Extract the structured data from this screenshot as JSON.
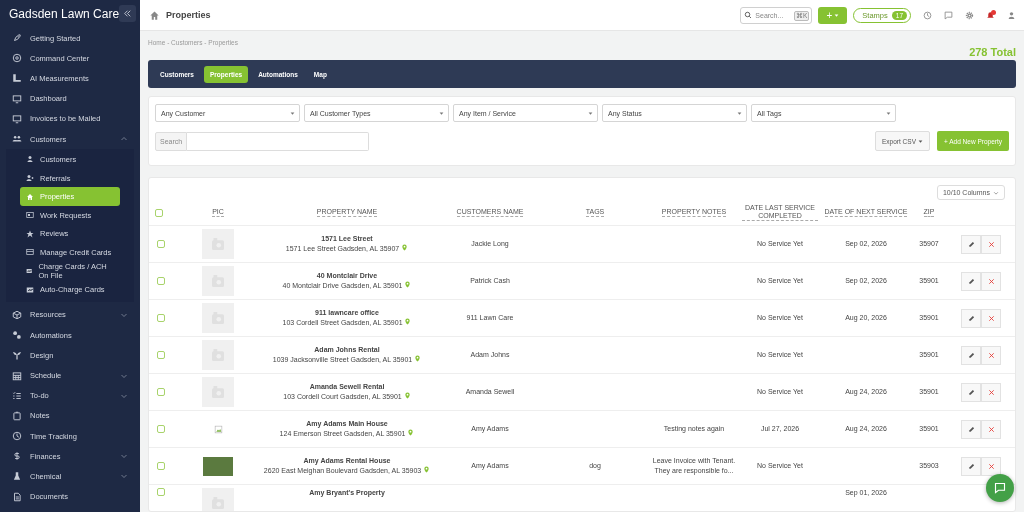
{
  "sidebar": {
    "brand": "Gadsden Lawn Care",
    "items": [
      {
        "label": "Getting Started"
      },
      {
        "label": "Command Center"
      },
      {
        "label": "AI Measurements"
      },
      {
        "label": "Dashboard"
      },
      {
        "label": "Invoices to be Mailed"
      },
      {
        "label": "Customers",
        "expanded": true,
        "children": [
          {
            "label": "Customers",
            "selected": false
          },
          {
            "label": "Referrals",
            "selected": false
          },
          {
            "label": "Properties",
            "selected": true
          },
          {
            "label": "Work Requests",
            "selected": false
          },
          {
            "label": "Reviews",
            "selected": false
          },
          {
            "label": "Manage Credit Cards",
            "selected": false
          },
          {
            "label": "Charge Cards / ACH On File",
            "selected": false
          },
          {
            "label": "Auto-Charge Cards",
            "selected": false
          }
        ]
      },
      {
        "label": "Resources",
        "expanded": false
      },
      {
        "label": "Automations"
      },
      {
        "label": "Design"
      },
      {
        "label": "Schedule",
        "expanded": false
      },
      {
        "label": "To-do",
        "expanded": false
      },
      {
        "label": "Notes"
      },
      {
        "label": "Time Tracking"
      },
      {
        "label": "Finances",
        "expanded": false
      },
      {
        "label": "Chemical",
        "expanded": false
      },
      {
        "label": "Documents"
      }
    ]
  },
  "top_bar": {
    "title": "Properties",
    "search": {
      "placeholder": "Search...",
      "shortcut": "⌘K"
    },
    "add_button": "+",
    "stamps": {
      "label": "Stamps",
      "count": "17"
    },
    "notification": true
  },
  "breadcrumb": "Home - Customers - Properties",
  "total": "278 Total",
  "tabs": [
    {
      "label": "Customers",
      "selected": false
    },
    {
      "label": "Properties",
      "selected": true
    },
    {
      "label": "Automations",
      "selected": false
    },
    {
      "label": "Map",
      "selected": false
    }
  ],
  "filters": [
    "Any Customer",
    "All Customer Types",
    "Any Item / Service",
    "Any Status",
    "All Tags"
  ],
  "search": {
    "label": "Search"
  },
  "export_button": "Export CSV",
  "add_property_button": "+ Add New Property",
  "table": {
    "columns_button": "10/10 Columns",
    "all_checked": false,
    "columns": [
      "PIC",
      "PROPERTY NAME",
      "CUSTOMERS NAME",
      "TAGS",
      "PROPERTY NOTES",
      "DATE LAST SERVICE COMPLETED",
      "DATE OF NEXT SERVICE",
      "ZIP"
    ],
    "rows": [
      {
        "checked": false,
        "kind": "placeholder",
        "name": "1571 Lee Street",
        "address": "1571 Lee Street Gadsden, AL 35907",
        "customer": "Jackie Long",
        "tags": "",
        "notes": "",
        "last_service": "No Service Yet",
        "next_service": "Sep 02, 2026",
        "zip": "35907"
      },
      {
        "checked": false,
        "kind": "placeholder",
        "name": "40 Montclair Drive",
        "address": "40 Montclair Drive Gadsden, AL 35901",
        "customer": "Patrick Cash",
        "tags": "",
        "notes": "",
        "last_service": "No Service Yet",
        "next_service": "Sep 02, 2026",
        "zip": "35901"
      },
      {
        "checked": false,
        "kind": "placeholder",
        "name": "911 lawncare office",
        "address": "103 Cordell Street Gadsden, AL 35901",
        "customer": "911 Lawn Care",
        "tags": "",
        "notes": "",
        "last_service": "No Service Yet",
        "next_service": "Aug 20, 2026",
        "zip": "35901"
      },
      {
        "checked": false,
        "kind": "placeholder",
        "name": "Adam Johns Rental",
        "address": "1039 Jacksonville Street Gadsden, AL 35901",
        "customer": "Adam Johns",
        "tags": "",
        "notes": "",
        "last_service": "No Service Yet",
        "next_service": "",
        "zip": "35901"
      },
      {
        "checked": false,
        "kind": "placeholder",
        "name": "Amanda Sewell Rental",
        "address": "103 Cordell Court Gadsden, AL 35901",
        "customer": "Amanda Sewell",
        "tags": "",
        "notes": "",
        "last_service": "No Service Yet",
        "next_service": "Aug 24, 2026",
        "zip": "35901"
      },
      {
        "checked": false,
        "kind": "broken",
        "name": "Amy Adams Main House",
        "address": "124 Emerson Street Gadsden, AL 35901",
        "customer": "Amy Adams",
        "tags": "",
        "notes": "Testing notes again",
        "last_service": "Jul 27, 2026",
        "next_service": "Aug 24, 2026",
        "zip": "35901"
      },
      {
        "checked": false,
        "kind": "photo",
        "name": "Amy Adams Rental House",
        "address": "2620 East Meighan Boulevard Gadsden, AL 35903",
        "customer": "Amy Adams",
        "tags": "dog",
        "notes": "Leave Invoice with Tenant. They are responsible fo...",
        "last_service": "No Service Yet",
        "next_service": "",
        "zip": "35903"
      },
      {
        "checked": false,
        "kind": "placeholder",
        "name": "Amy Bryant's Property",
        "address": "",
        "customer": "",
        "tags": "",
        "notes": "",
        "last_service": "",
        "next_service": "Sep 01, 2026",
        "zip": ""
      }
    ]
  }
}
